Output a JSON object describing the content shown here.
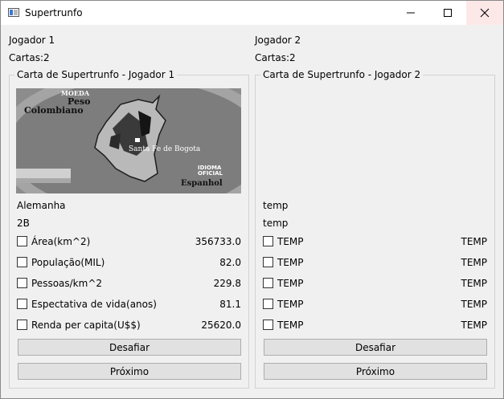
{
  "window": {
    "title": "Supertrunfo"
  },
  "player1": {
    "name": "Jogador 1",
    "cards": "Cartas:2",
    "group_title": "Carta de Supertrunfo - Jogador 1",
    "card": {
      "image": {
        "text_moeda": "MOEDA",
        "text_peso": "Peso",
        "text_colombiano": "Colombiano",
        "text_city": "Santa Fe de Bogota",
        "text_idioma": "IDIOMA",
        "text_oficial": "OFICIAL",
        "text_espanhol": "Espanhol"
      },
      "name": "Alemanha",
      "code": "2B",
      "attributes": [
        {
          "label": "Área(km^2)",
          "value": "356733.0"
        },
        {
          "label": "População(MIL)",
          "value": "82.0"
        },
        {
          "label": "Pessoas/km^2",
          "value": "229.8"
        },
        {
          "label": "Espectativa de vida(anos)",
          "value": "81.1"
        },
        {
          "label": "Renda per capita(U$$)",
          "value": "25620.0"
        }
      ]
    },
    "challenge_label": "Desafiar",
    "next_label": "Próximo"
  },
  "player2": {
    "name": "Jogador 2",
    "cards": "Cartas:2",
    "group_title": "Carta de Supertrunfo - Jogador 2",
    "card": {
      "name": "temp",
      "code": "temp",
      "attributes": [
        {
          "label": "TEMP",
          "value": "TEMP"
        },
        {
          "label": "TEMP",
          "value": "TEMP"
        },
        {
          "label": "TEMP",
          "value": "TEMP"
        },
        {
          "label": "TEMP",
          "value": "TEMP"
        },
        {
          "label": "TEMP",
          "value": "TEMP"
        }
      ]
    },
    "challenge_label": "Desafiar",
    "next_label": "Próximo"
  }
}
